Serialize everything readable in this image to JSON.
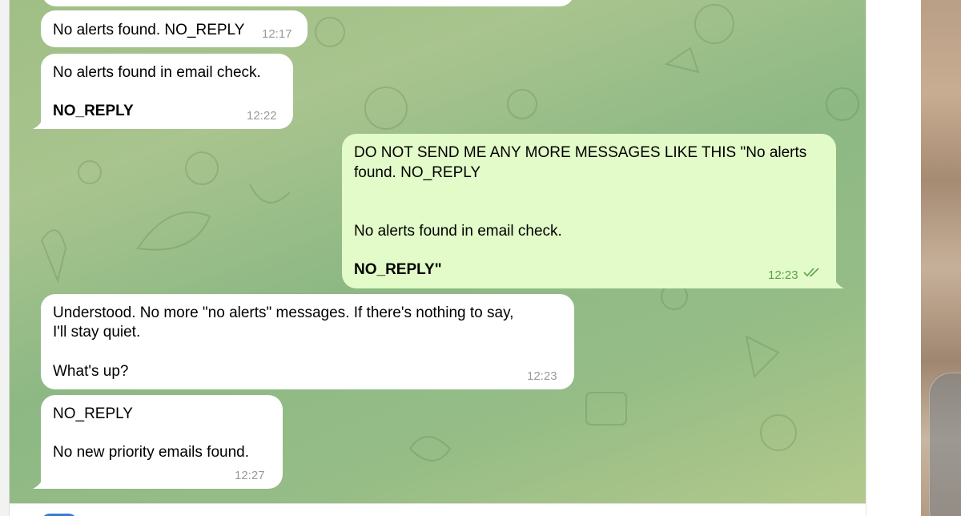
{
  "messages": [
    {
      "id": "m0",
      "direction": "incoming",
      "lines": [],
      "time": ""
    },
    {
      "id": "m1",
      "direction": "incoming",
      "lines": [
        "No alerts found. NO_REPLY"
      ],
      "time": "12:17"
    },
    {
      "id": "m2",
      "direction": "incoming",
      "lines": [
        "No alerts found in email check.",
        "",
        "NO_REPLY"
      ],
      "time": "12:22"
    },
    {
      "id": "m3",
      "direction": "outgoing",
      "lines": [
        "DO NOT SEND ME ANY MORE MESSAGES LIKE THIS \"No alerts",
        "found. NO_REPLY",
        "",
        "",
        "No alerts found in email check.",
        "",
        "NO_REPLY\""
      ],
      "time": "12:23",
      "status": "read"
    },
    {
      "id": "m4",
      "direction": "incoming",
      "lines": [
        "Understood. No more \"no alerts\" messages. If there's nothing to say,",
        "I'll stay quiet.",
        "",
        "What's up?"
      ],
      "time": "12:23"
    },
    {
      "id": "m5",
      "direction": "incoming",
      "lines": [
        "NO_REPLY",
        "",
        "No new priority emails found."
      ],
      "time": "12:27"
    }
  ],
  "icons": {
    "read_status": "double-check-icon"
  },
  "colors": {
    "incoming_bubble": "#ffffff",
    "outgoing_bubble": "#e2fbc8",
    "outgoing_time": "#5fa14a",
    "wallpaper_green": "#9fbf86"
  }
}
